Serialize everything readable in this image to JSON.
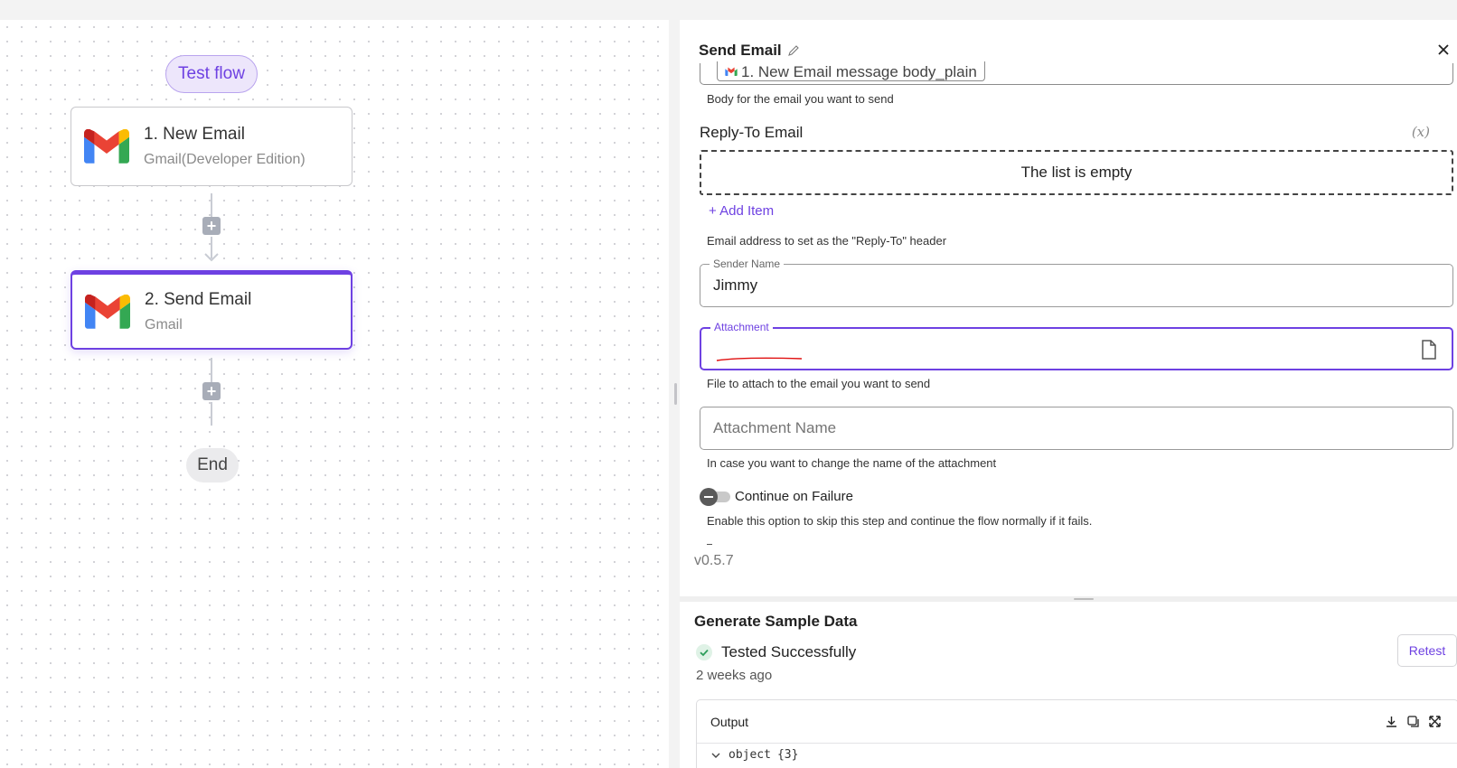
{
  "canvas": {
    "test_flow_label": "Test flow",
    "steps": [
      {
        "title": "1. New Email",
        "subtitle": "Gmail(Developer Edition)"
      },
      {
        "title": "2. Send Email",
        "subtitle": "Gmail"
      }
    ],
    "end_label": "End"
  },
  "panel": {
    "title": "Send Email",
    "body_chip": "1. New Email message body_plain",
    "body_help": "Body for the email you want to send",
    "reply_to": {
      "label": "Reply-To Email",
      "fx": "(x)",
      "empty_text": "The list is empty",
      "add_item": "+ Add Item",
      "help": "Email address to set as the \"Reply-To\" header"
    },
    "sender_name": {
      "label": "Sender Name",
      "value": "Jimmy"
    },
    "attachment": {
      "label": "Attachment",
      "value": "",
      "help": "File to attach to the email you want to send"
    },
    "attachment_name": {
      "placeholder": "Attachment Name",
      "help": "In case you want to change the name of the attachment"
    },
    "continue_on_failure": {
      "label": "Continue on Failure",
      "enabled": false,
      "help": "Enable this option to skip this step and continue the flow normally if it fails."
    },
    "version": "v0.5.7"
  },
  "sample_data": {
    "title": "Generate Sample Data",
    "status": "Tested Successfully",
    "time": "2 weeks ago",
    "retest_label": "Retest",
    "output_label": "Output",
    "object_label": "object",
    "object_count": "{3}"
  },
  "colors": {
    "accent": "#6e41e2",
    "success": "#2e9e5b",
    "annotation": "#e01010"
  }
}
